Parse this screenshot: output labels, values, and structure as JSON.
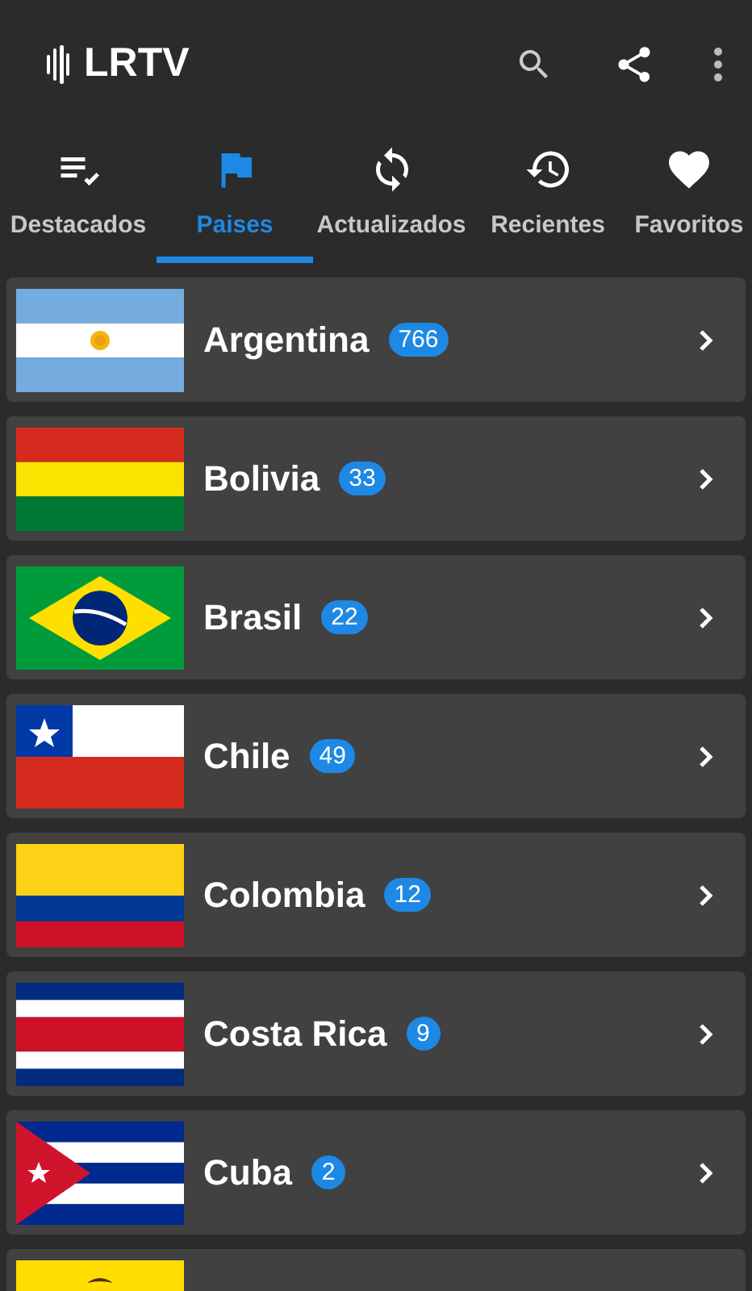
{
  "app_bar": {
    "title": "LRTV"
  },
  "tabs": [
    {
      "label": "Destacados",
      "selected": false
    },
    {
      "label": "Paises",
      "selected": true
    },
    {
      "label": "Actualizados",
      "selected": false
    },
    {
      "label": "Recientes",
      "selected": false
    },
    {
      "label": "Favoritos",
      "selected": false
    }
  ],
  "countries": [
    {
      "kind": "full",
      "name": "Argentina",
      "count": "766"
    },
    {
      "kind": "full",
      "name": "Bolivia",
      "count": "33"
    },
    {
      "kind": "full",
      "name": "Brasil",
      "count": "22"
    },
    {
      "kind": "full",
      "name": "Chile",
      "count": "49"
    },
    {
      "kind": "full",
      "name": "Colombia",
      "count": "12"
    },
    {
      "kind": "full",
      "name": "Costa Rica",
      "count": "9"
    },
    {
      "kind": "full",
      "name": "Cuba",
      "count": "2"
    },
    {
      "kind": "cut_off"
    }
  ]
}
